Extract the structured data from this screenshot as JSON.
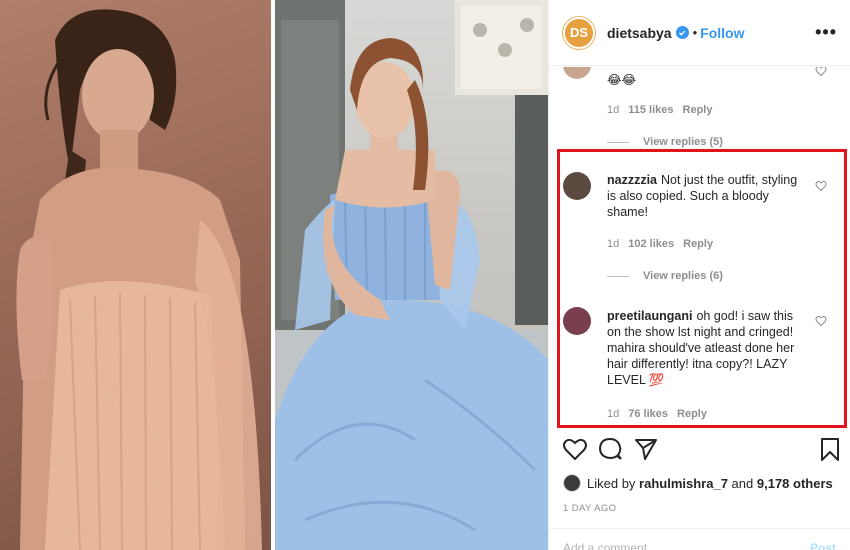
{
  "header": {
    "avatar_initials": "DS",
    "username": "dietsabya",
    "separator": "•",
    "follow_label": "Follow",
    "more_label": "•••"
  },
  "comments": [
    {
      "text": "😂😂",
      "time": "1d",
      "likes": "115 likes",
      "reply_label": "Reply",
      "view_replies": "View replies (5)"
    },
    {
      "username": "nazzzzia",
      "text": "Not just the outfit, styling is also copied. Such a bloody shame!",
      "time": "1d",
      "likes": "102 likes",
      "reply_label": "Reply",
      "view_replies": "View replies (6)"
    },
    {
      "username": "preetilaungani",
      "text": "oh god! i saw this on the show lst night and cringed! mahira should've atleast done her hair differently! itna copy?! LAZY LEVEL 💯",
      "time": "1d",
      "likes": "76 likes",
      "reply_label": "Reply"
    }
  ],
  "likes_line": {
    "prefix": "Liked by",
    "user": "rahulmishra_7",
    "middle": "and",
    "count": "9,178 others"
  },
  "time_ago": "1 DAY AGO",
  "add_comment_placeholder": "Add a comment...",
  "post_label": "Post",
  "colors": {
    "accent": "#3897f0",
    "highlight_box": "#e3131b",
    "avatar_bg": "#e7a03f",
    "muted_text": "#8e8e8e"
  },
  "icons": [
    "verified-badge-icon",
    "heart-icon",
    "comment-icon",
    "share-icon",
    "bookmark-icon",
    "more-options-icon"
  ]
}
